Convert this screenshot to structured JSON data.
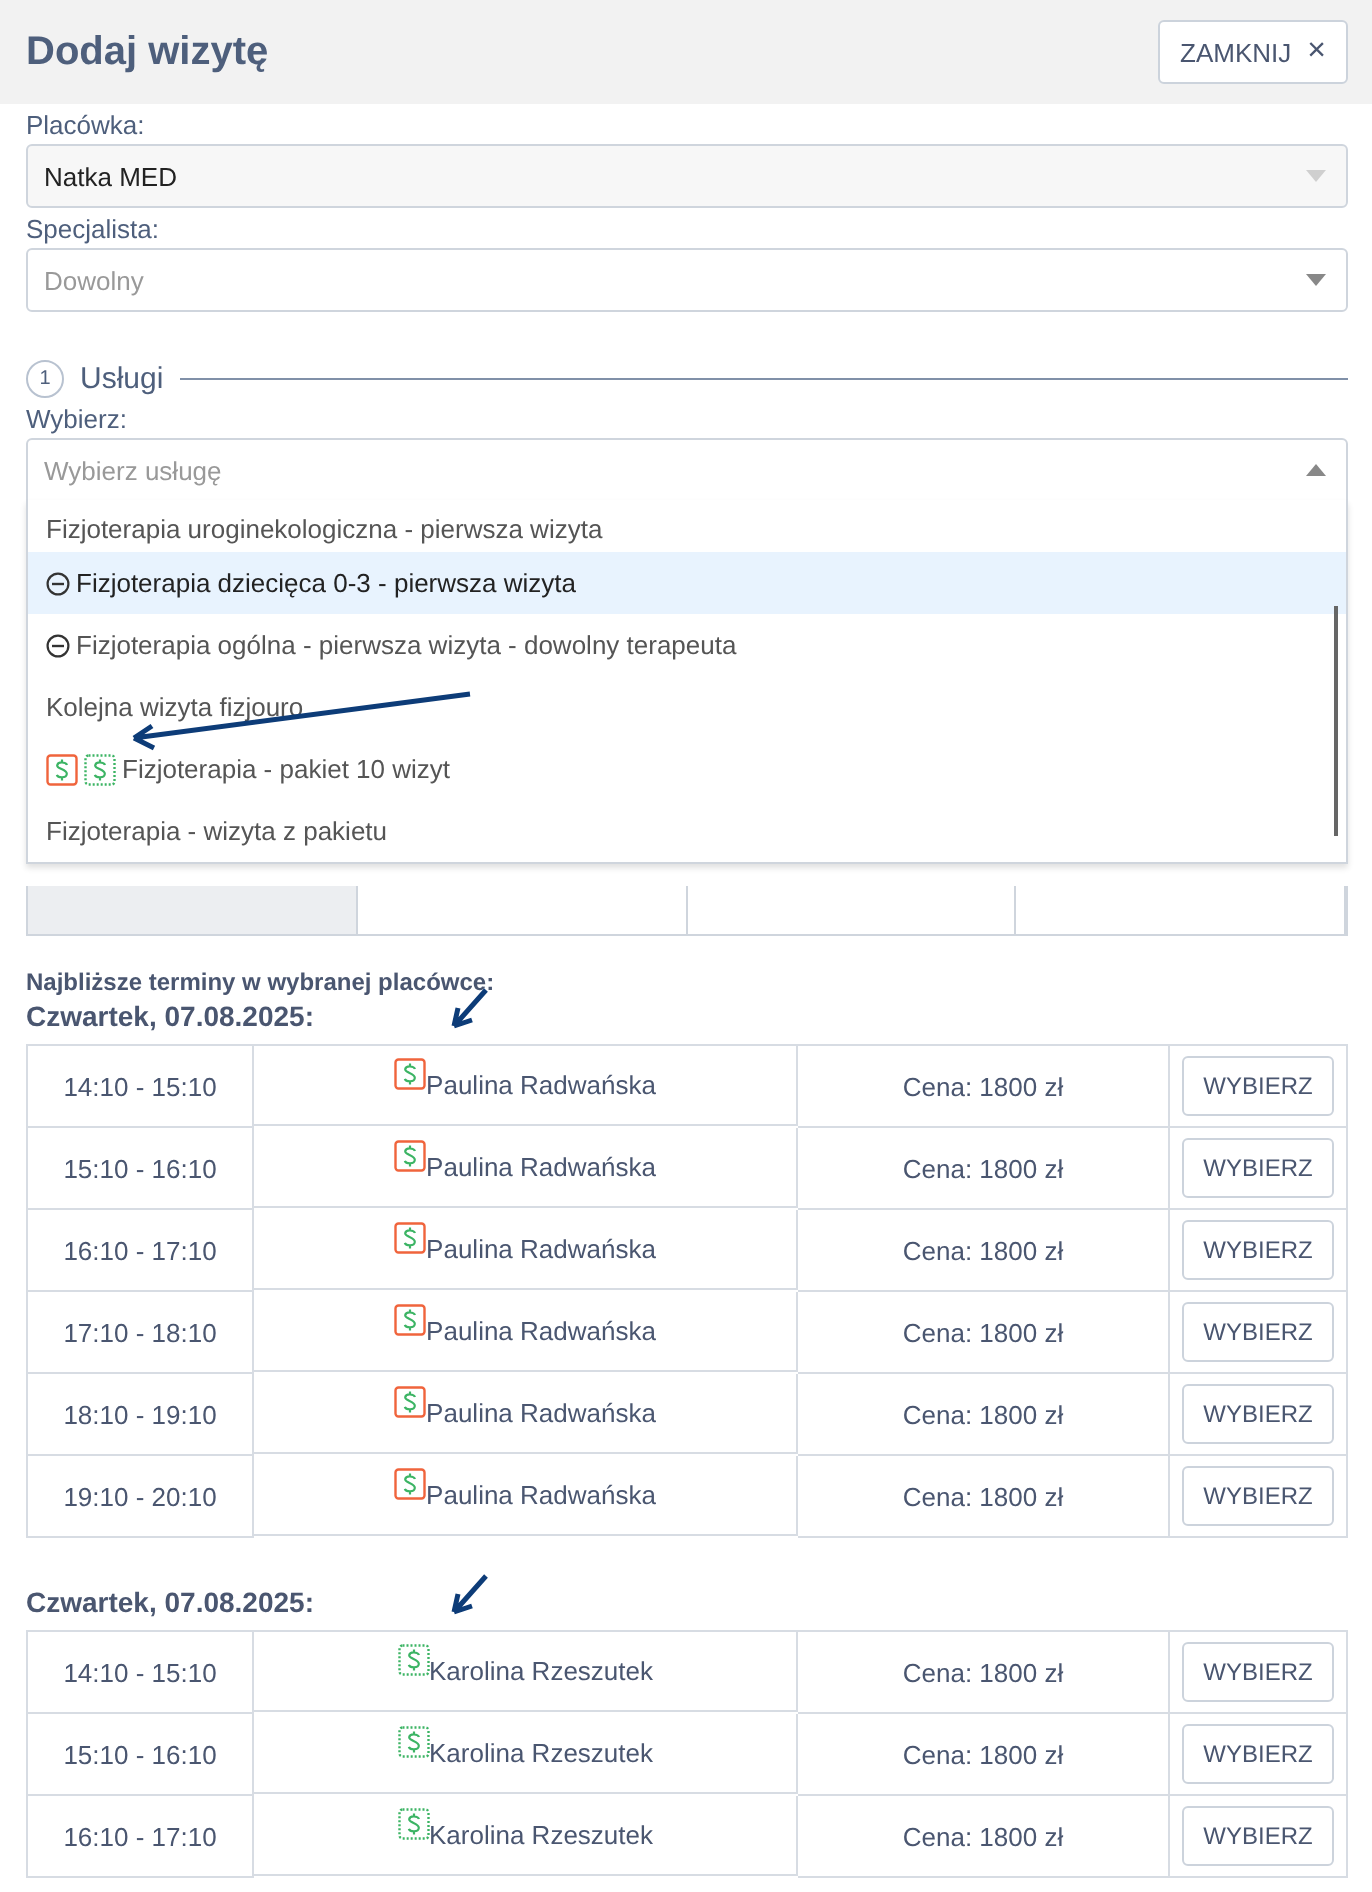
{
  "header": {
    "title": "Dodaj wizytę",
    "close_button": "ZAMKNIJ",
    "close_icon": "×"
  },
  "fields": [
    {
      "label": "Placówka:",
      "value": "Natka MED",
      "disabled": true
    },
    {
      "label": "Specjalista:",
      "placeholder": "Dowolny",
      "disabled": false
    }
  ],
  "section": {
    "number": "1",
    "title": "Usługi"
  },
  "service_select": {
    "label": "Wybierz:",
    "placeholder": "Wybierz usługę",
    "expanded": true,
    "options": [
      {
        "label": "Fizjoterapia uroginekologiczna - pierwsza wizyta",
        "kind": "plain",
        "selected": false
      },
      {
        "label": "Fizjoterapia dziecięca 0-3 - pierwsza wizyta",
        "kind": "blocked",
        "selected": true
      },
      {
        "label": "Fizjoterapia ogólna - pierwsza wizyta - dowolny terapeuta",
        "kind": "blocked",
        "selected": false
      },
      {
        "label": "Kolejna wizyta fizjouro",
        "kind": "plain",
        "selected": false
      },
      {
        "label": "Fizjoterapia - pakiet 10 wizyt",
        "kind": "package",
        "selected": false
      },
      {
        "label": "Fizjoterapia - wizyta z pakietu",
        "kind": "plain",
        "selected": false
      }
    ]
  },
  "slots_heading": "Najbliższe terminy w wybranej placówce:",
  "days": [
    {
      "date": "Czwartek, 07.08.2025:",
      "rows": [
        {
          "time": "14:10 - 15:10",
          "kind": "solid",
          "specialist": "Paulina Radwańska",
          "price": "Cena: 1800 zł",
          "button": "WYBIERZ"
        },
        {
          "time": "15:10 - 16:10",
          "kind": "solid",
          "specialist": "Paulina Radwańska",
          "price": "Cena: 1800 zł",
          "button": "WYBIERZ"
        },
        {
          "time": "16:10 - 17:10",
          "kind": "solid",
          "specialist": "Paulina Radwańska",
          "price": "Cena: 1800 zł",
          "button": "WYBIERZ"
        },
        {
          "time": "17:10 - 18:10",
          "kind": "solid",
          "specialist": "Paulina Radwańska",
          "price": "Cena: 1800 zł",
          "button": "WYBIERZ"
        },
        {
          "time": "18:10 - 19:10",
          "kind": "solid",
          "specialist": "Paulina Radwańska",
          "price": "Cena: 1800 zł",
          "button": "WYBIERZ"
        },
        {
          "time": "19:10 - 20:10",
          "kind": "solid",
          "specialist": "Paulina Radwańska",
          "price": "Cena: 1800 zł",
          "button": "WYBIERZ"
        }
      ]
    },
    {
      "date": "Czwartek, 07.08.2025:",
      "rows": [
        {
          "time": "14:10 - 15:10",
          "kind": "dotted",
          "specialist": "Karolina Rzeszutek",
          "price": "Cena: 1800 zł",
          "button": "WYBIERZ"
        },
        {
          "time": "15:10 - 16:10",
          "kind": "dotted",
          "specialist": "Karolina Rzeszutek",
          "price": "Cena: 1800 zł",
          "button": "WYBIERZ"
        },
        {
          "time": "16:10 - 17:10",
          "kind": "dotted",
          "specialist": "Karolina Rzeszutek",
          "price": "Cena: 1800 zł",
          "button": "WYBIERZ"
        }
      ]
    }
  ]
}
